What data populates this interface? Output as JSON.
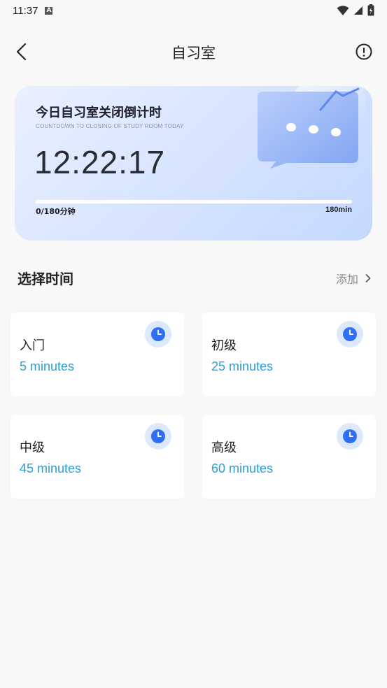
{
  "status": {
    "time": "11:37",
    "badge": "A"
  },
  "nav": {
    "title": "自习室"
  },
  "countdown": {
    "title": "今日自习室关闭倒计时",
    "subtitle": "COUNTDOWN TO CLOSING OF STUDY ROOM TODAY",
    "timer": "12:22:17",
    "progress_label": "0/180分钟",
    "progress_max_label": "180min",
    "progress_fraction": 1.0
  },
  "section": {
    "title": "选择时间",
    "add_label": "添加"
  },
  "tiles": [
    {
      "label": "入门",
      "value": "5 minutes"
    },
    {
      "label": "初级",
      "value": "25 minutes"
    },
    {
      "label": "中级",
      "value": "45 minutes"
    },
    {
      "label": "高级",
      "value": "60 minutes"
    }
  ],
  "colors": {
    "accent": "#2f9ed4",
    "progress": "#3d7cff",
    "clock": "#2f6ef5"
  },
  "icons": [
    "back-arrow-icon",
    "info-icon",
    "clock-icon",
    "chevron-right-icon",
    "wifi-icon",
    "signal-icon",
    "battery-icon"
  ]
}
